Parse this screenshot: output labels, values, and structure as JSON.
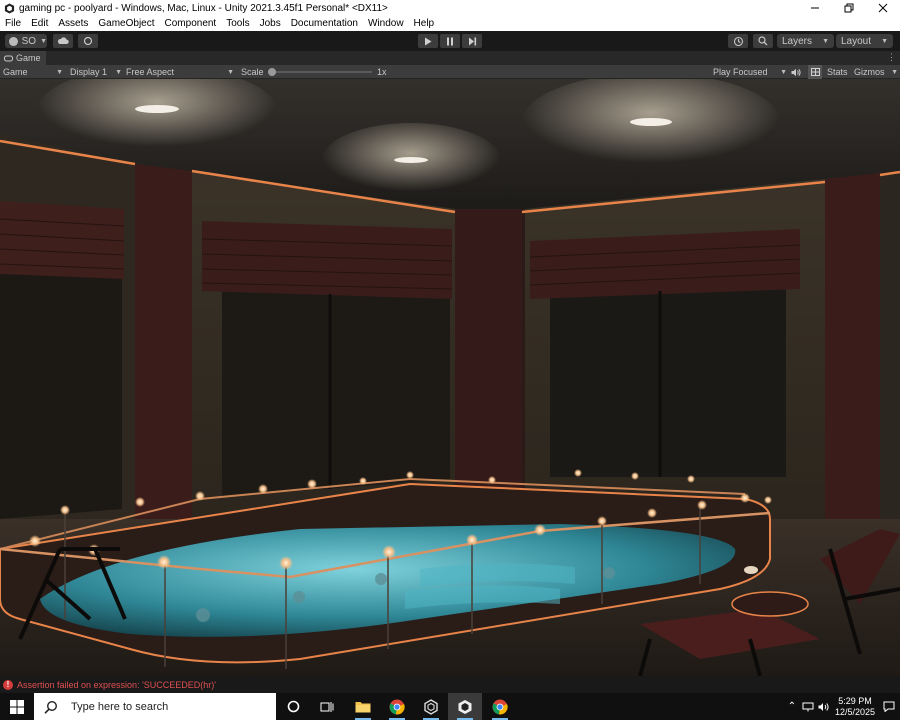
{
  "window": {
    "title": "gaming pc - poolyard - Windows, Mac, Linux - Unity 2021.3.45f1 Personal* <DX11>",
    "app_icon": "unity-icon",
    "buttons": [
      "minimize",
      "maximize",
      "close"
    ]
  },
  "menu": [
    "File",
    "Edit",
    "Assets",
    "GameObject",
    "Component",
    "Tools",
    "Jobs",
    "Documentation",
    "Window",
    "Help"
  ],
  "toolbar": {
    "account_label": "SO",
    "layers_label": "Layers",
    "layout_label": "Layout",
    "play_icons": [
      "play-icon",
      "pause-icon",
      "step-icon"
    ]
  },
  "tab": {
    "label": "Game"
  },
  "game_view": {
    "mode": "Game",
    "display": "Display 1",
    "aspect": "Free Aspect",
    "scale_label": "Scale",
    "scale_value": "1x",
    "scale_level": 0.0,
    "play_mode": "Play Focused",
    "stats_label": "Stats",
    "gizmos_label": "Gizmos"
  },
  "console": {
    "message": "Assertion failed on expression: 'SUCCEEDED(hr)'",
    "icon": "error-icon"
  },
  "taskbar": {
    "search_placeholder": "Type here to search",
    "apps": [
      "cortana-icon",
      "task-view-icon",
      "file-explorer-icon",
      "chrome-icon",
      "unity-hub-icon",
      "unity-icon",
      "chrome-icon"
    ],
    "time": "5:29 PM",
    "date": "12/5/2025"
  },
  "colors": {
    "accent_glow": "#e8844a",
    "water": "#3fa8b8",
    "error": "#e05050",
    "editor_dark": "#3c3c3c"
  }
}
